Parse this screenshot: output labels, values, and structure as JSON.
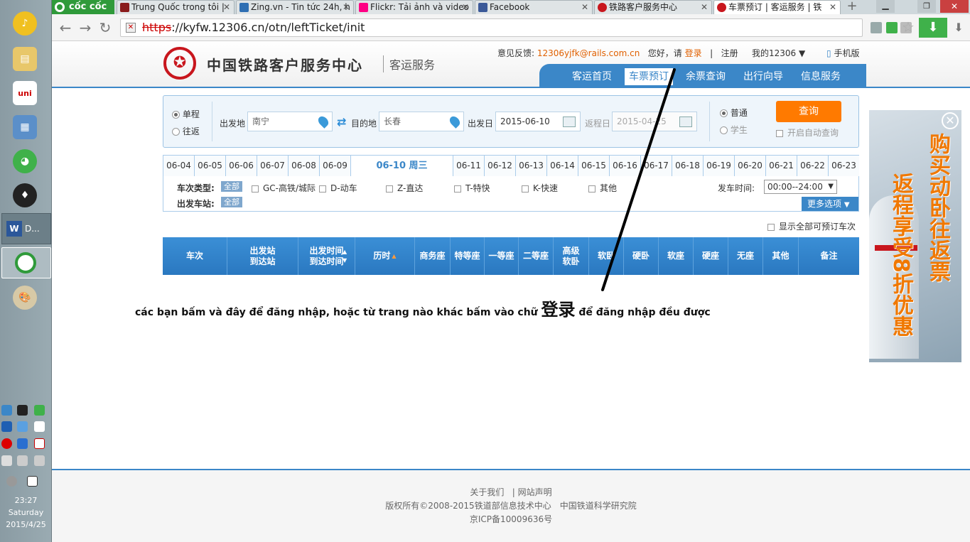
{
  "taskbar": {
    "word_label": "D...",
    "clock": {
      "time": "23:27",
      "day": "Saturday",
      "date": "2015/4/25"
    }
  },
  "browser": {
    "brand": "cốc cốc",
    "tabs": [
      {
        "title": "Trung Quốc trong tôi |",
        "color": "#8a1b1b"
      },
      {
        "title": "Zing.vn - Tin tức 24h, h",
        "color": "#2f6fb3"
      },
      {
        "title": "Flickr: Tải ảnh và video",
        "color": "#ff0084"
      },
      {
        "title": "Facebook",
        "color": "#3b5998"
      },
      {
        "title": "铁路客户服务中心",
        "color": "#c8161d"
      },
      {
        "title": "车票预订 | 客运服务 | 铁",
        "color": "#c8161d"
      }
    ],
    "url": {
      "scheme": "https",
      "rest": "://kyfw.12306.cn/otn/leftTicket/init"
    }
  },
  "header": {
    "site_title": "中国铁路客户服务中心",
    "site_sub": "客运服务",
    "feedback": "意见反馈:",
    "email": "12306yjfk@rails.com.cn",
    "greeting": "您好，请",
    "login": "登录",
    "sep": "|",
    "register": "注册",
    "my12306": "我的12306",
    "mobile": "手机版",
    "nav": [
      "客运首页",
      "车票预订",
      "余票查询",
      "出行向导",
      "信息服务"
    ]
  },
  "search": {
    "oneway": "单程",
    "roundtrip": "往返",
    "from_label": "出发地",
    "from_value": "南宁",
    "to_label": "目的地",
    "to_value": "长春",
    "depart_label": "出发日",
    "depart_value": "2015-06-10",
    "return_label": "返程日",
    "return_value": "2015-04-25",
    "normal": "普通",
    "student": "学生",
    "query": "查询",
    "auto": "开启自动查询"
  },
  "dates": [
    "06-04",
    "06-05",
    "06-06",
    "06-07",
    "06-08",
    "06-09",
    "06-10 周三",
    "06-11",
    "06-12",
    "06-13",
    "06-14",
    "06-15",
    "06-16",
    "06-17",
    "06-18",
    "06-19",
    "06-20",
    "06-21",
    "06-22",
    "06-23"
  ],
  "filters": {
    "type_label": "车次类型:",
    "all": "全部",
    "types": [
      "GC-高铁/城际",
      "D-动车",
      "Z-直达",
      "T-特快",
      "K-快速",
      "其他"
    ],
    "station_label": "出发车站:",
    "time_label": "发车时间:",
    "time_value": "00:00--24:00",
    "more": "更多选项"
  },
  "showall": "显示全部可预订车次",
  "table_headers": [
    "车次",
    "出发站\n到达站",
    "出发时间\n到达时间",
    "历时",
    "商务座",
    "特等座",
    "一等座",
    "二等座",
    "高级\n软卧",
    "软卧",
    "硬卧",
    "软座",
    "硬座",
    "无座",
    "其他",
    "备注"
  ],
  "note": {
    "before": "các bạn bấm và đây để đăng nhập, hoặc từ trang nào khác bấm vào chữ",
    "big": "登录",
    "after": "để đăng nhập đều được"
  },
  "ad": {
    "line1": "购买动卧往返票",
    "line2": "返程享受8折优惠"
  },
  "footer": {
    "about": "关于我们",
    "statement": "网站声明",
    "copyright": "版权所有©2008-2015铁道部信息技术中心　中国铁道科学研究院",
    "icp": "京ICP备10009636号"
  }
}
